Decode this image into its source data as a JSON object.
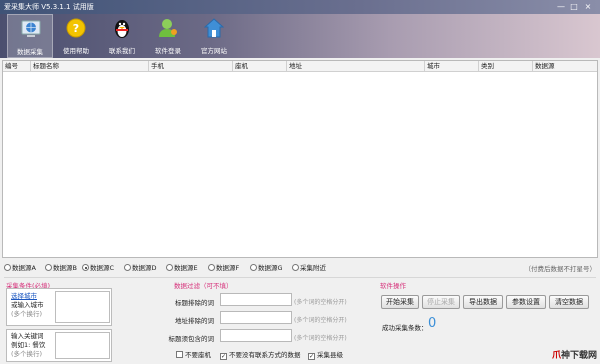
{
  "window": {
    "title": "爱采集大师 V5.3.1.1 试用版",
    "controls": [
      "—",
      "□",
      "×"
    ]
  },
  "toolbar": [
    {
      "label": "数据采集",
      "icon": "globe-icon",
      "active": true
    },
    {
      "label": "使用帮助",
      "icon": "help-icon",
      "active": false
    },
    {
      "label": "联系我们",
      "icon": "qq-penguin-icon",
      "active": false
    },
    {
      "label": "软件登录",
      "icon": "user-icon",
      "active": false
    },
    {
      "label": "官方网站",
      "icon": "home-icon",
      "active": false
    }
  ],
  "grid": {
    "columns": [
      "编号",
      "标题名称",
      "手机",
      "座机",
      "地址",
      "城市",
      "类别",
      "数据源"
    ]
  },
  "sources": [
    {
      "label": "数据源A",
      "checked": false
    },
    {
      "label": "数据源B",
      "checked": false
    },
    {
      "label": "数据源C",
      "checked": true
    },
    {
      "label": "数据源D",
      "checked": false
    },
    {
      "label": "数据源E",
      "checked": false
    },
    {
      "label": "数据源F",
      "checked": false
    },
    {
      "label": "数据源G",
      "checked": false
    },
    {
      "label": "采集附近",
      "checked": false
    }
  ],
  "source_hint": "（付费后数据不打星号）",
  "conditions": {
    "title": "采集条件(必填)",
    "city_link": "选择城市",
    "city_text": "或输入城市",
    "city_hint": "(多个换行)",
    "kw_text1": "输入关键词",
    "kw_text2": "例如1: 餐饮",
    "kw_hint": "(多个换行)"
  },
  "filter": {
    "title": "数据过滤（可不填）",
    "fields": [
      {
        "label": "标题排除的词",
        "hint": "(多个词的空格分开)"
      },
      {
        "label": "地址排除的词",
        "hint": "(多个词的空格分开)"
      },
      {
        "label": "标题须包含的词",
        "hint": "(多个词的空格分开)"
      }
    ],
    "checks": [
      {
        "label": "不要座机",
        "checked": false
      },
      {
        "label": "不要没有联系方式的数据",
        "checked": true
      },
      {
        "label": "采集县级",
        "checked": true
      }
    ]
  },
  "operations": {
    "title": "软件操作",
    "buttons": [
      {
        "label": "开始采集",
        "disabled": false
      },
      {
        "label": "停止采集",
        "disabled": true
      },
      {
        "label": "导出数据",
        "disabled": false
      },
      {
        "label": "参数设置",
        "disabled": false
      },
      {
        "label": "清空数据",
        "disabled": false
      }
    ],
    "success_label": "成功采集条数：",
    "success_count": "0"
  },
  "watermark": {
    "prefix": "爪",
    "rest": "神下载网"
  }
}
